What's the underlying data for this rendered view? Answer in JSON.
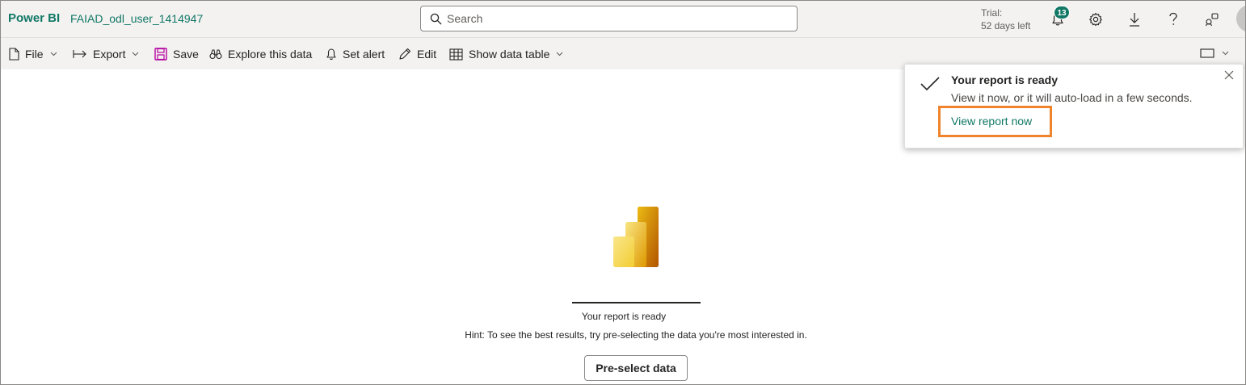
{
  "header": {
    "app_name": "Power BI",
    "workspace": "FAIAD_odl_user_1414947",
    "search_placeholder": "Search",
    "trial_label": "Trial:",
    "trial_days": "52 days left",
    "notification_count": "13",
    "icons": [
      "bell-icon",
      "gear-icon",
      "download-icon",
      "help-icon",
      "share-icon",
      "avatar"
    ]
  },
  "toolbar": {
    "file": "File",
    "export": "Export",
    "save": "Save",
    "explore": "Explore this data",
    "set_alert": "Set alert",
    "edit": "Edit",
    "show_data_table": "Show data table"
  },
  "toast": {
    "title": "Your report is ready",
    "body": "View it now, or it will auto-load in a few seconds.",
    "link": "View report now"
  },
  "main": {
    "ready_text": "Your report is ready",
    "hint_text": "Hint: To see the best results, try pre-selecting the data you're most interested in.",
    "preselect_button": "Pre-select data"
  },
  "colors": {
    "brand_green": "#117865",
    "highlight_orange": "#f0842c",
    "logo_gold_dark": "#e8b700",
    "logo_gold_mid": "#f2c811",
    "logo_gold_light": "#f7dd6b"
  }
}
